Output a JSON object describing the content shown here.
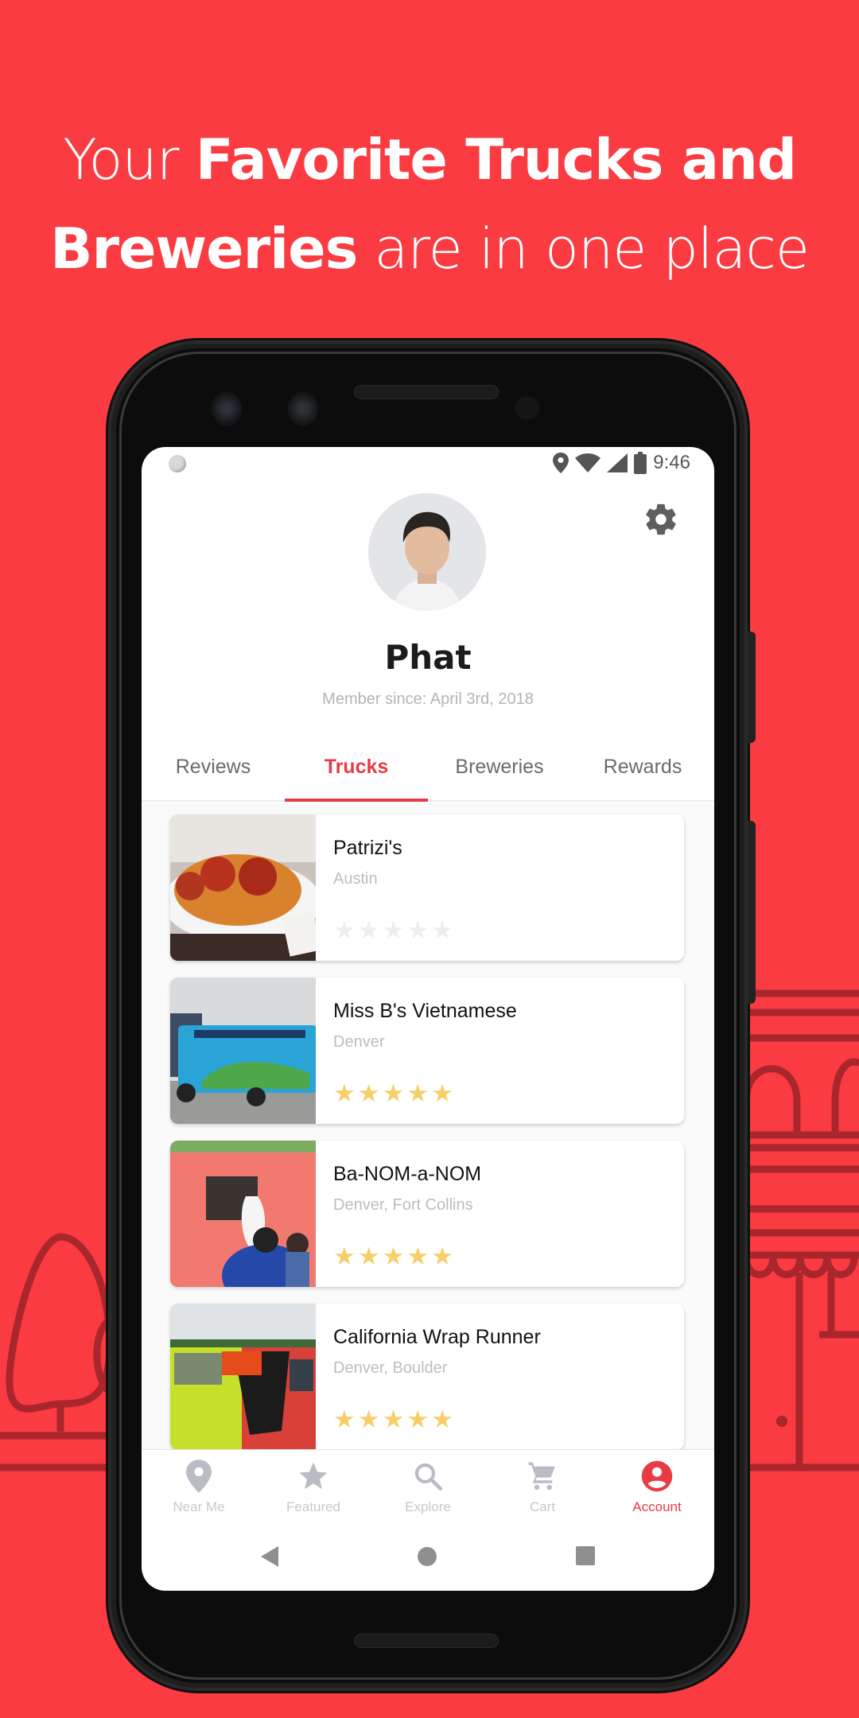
{
  "headline": {
    "line1_light": "Your",
    "line1_bold": "Favorite Trucks and",
    "line2_bold": "Breweries",
    "line2_light": "are in one place"
  },
  "colors": {
    "background": "#fa3b41",
    "accent": "#e83b44",
    "star_filled": "#f7cf6a",
    "star_empty": "#eeeeee",
    "inactive_icon": "#b9bcc4"
  },
  "statusbar": {
    "time": "9:46",
    "icons": [
      "location-icon",
      "wifi-icon",
      "signal-icon",
      "battery-icon"
    ]
  },
  "profile": {
    "name": "Phat",
    "member_since": "Member since: April 3rd, 2018",
    "settings_icon": "gear-icon"
  },
  "tabs": [
    {
      "label": "Reviews",
      "active": false
    },
    {
      "label": "Trucks",
      "active": true
    },
    {
      "label": "Breweries",
      "active": false
    },
    {
      "label": "Rewards",
      "active": false
    }
  ],
  "trucks": [
    {
      "name": "Patrizi's",
      "location": "Austin",
      "rating": 0,
      "max_rating": 5
    },
    {
      "name": "Miss B's Vietnamese",
      "location": "Denver",
      "rating": 5,
      "max_rating": 5
    },
    {
      "name": "Ba-NOM-a-NOM",
      "location": "Denver, Fort Collins",
      "rating": 5,
      "max_rating": 5
    },
    {
      "name": "California Wrap Runner",
      "location": "Denver, Boulder",
      "rating": 5,
      "max_rating": 5
    }
  ],
  "bottom_nav": [
    {
      "label": "Near Me",
      "icon": "location-pin-icon",
      "active": false
    },
    {
      "label": "Featured",
      "icon": "star-icon",
      "active": false
    },
    {
      "label": "Explore",
      "icon": "search-icon",
      "active": false
    },
    {
      "label": "Cart",
      "icon": "cart-icon",
      "active": false
    },
    {
      "label": "Account",
      "icon": "account-icon",
      "active": true
    }
  ],
  "system_nav": [
    "back-icon",
    "home-icon",
    "recents-icon"
  ]
}
